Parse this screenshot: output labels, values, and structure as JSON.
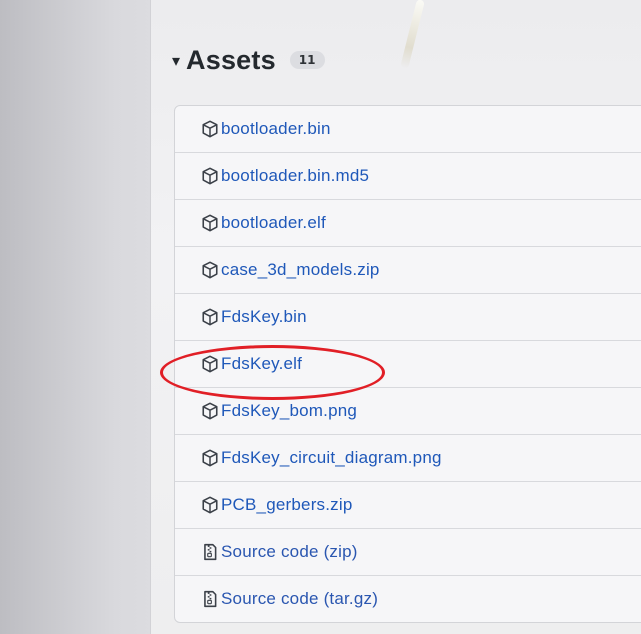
{
  "assets": {
    "toggle_icon": "triangle-down-icon",
    "title": "Assets",
    "count": "11",
    "link_color": "#1f58b9",
    "items": [
      {
        "label": "bootloader.bin",
        "icon": "package-icon"
      },
      {
        "label": "bootloader.bin.md5",
        "icon": "package-icon"
      },
      {
        "label": "bootloader.elf",
        "icon": "package-icon"
      },
      {
        "label": "case_3d_models.zip",
        "icon": "package-icon"
      },
      {
        "label": "FdsKey.bin",
        "icon": "package-icon"
      },
      {
        "label": "FdsKey.elf",
        "icon": "package-icon"
      },
      {
        "label": "FdsKey_bom.png",
        "icon": "package-icon"
      },
      {
        "label": "FdsKey_circuit_diagram.png",
        "icon": "package-icon"
      },
      {
        "label": "PCB_gerbers.zip",
        "icon": "package-icon"
      },
      {
        "label": "Source code (zip)",
        "icon": "file-zip-icon"
      },
      {
        "label": "Source code (tar.gz)",
        "icon": "file-zip-icon"
      }
    ]
  },
  "annotation": {
    "highlighted_item": "FdsKey.elf",
    "color": "#e11f26"
  }
}
